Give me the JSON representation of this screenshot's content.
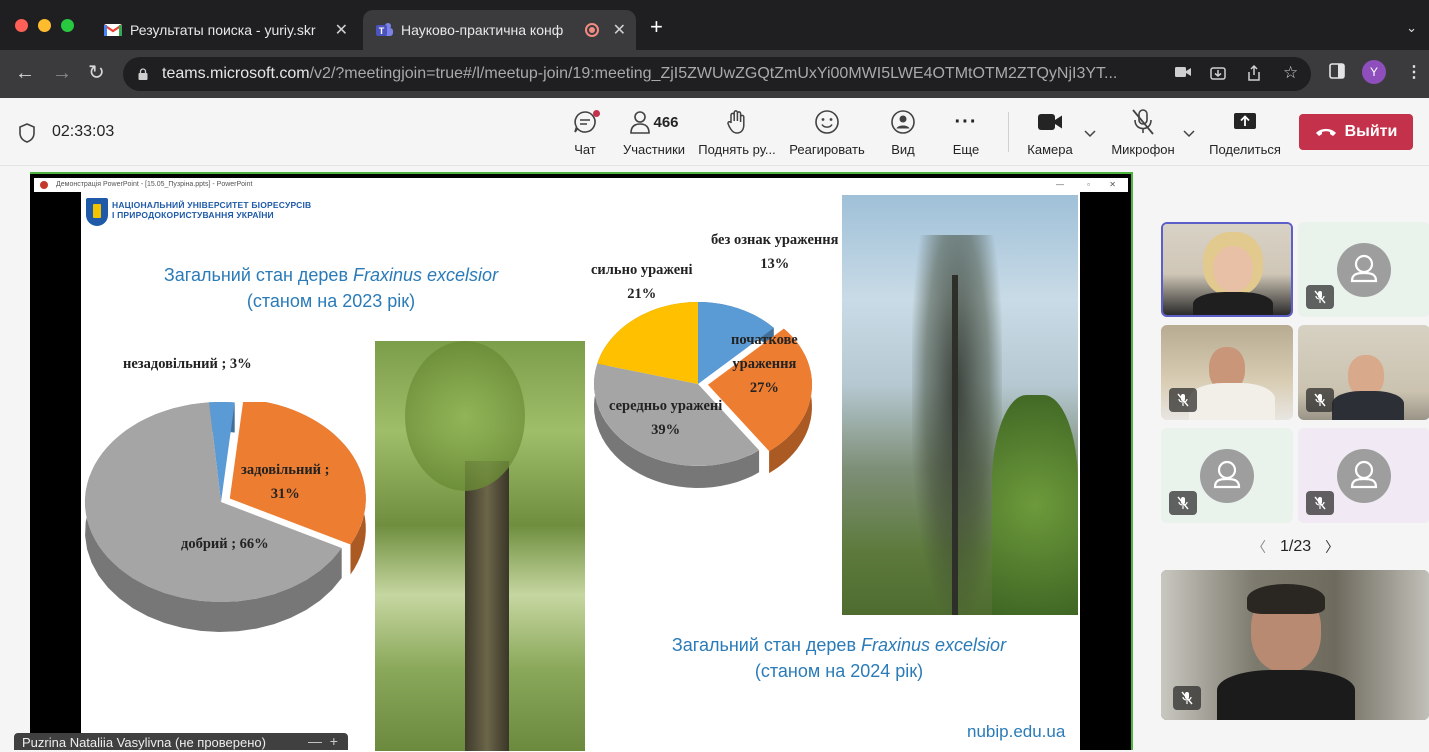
{
  "browser": {
    "tabs": [
      {
        "title": "Результаты поиска - yuriy.skr",
        "icon": "gmail-icon",
        "active": false
      },
      {
        "title": "Науково-практична конф",
        "icon": "teams-icon",
        "active": true,
        "recording": true
      }
    ],
    "url_host": "teams.microsoft.com",
    "url_path": "/v2/?meetingjoin=true#/l/meetup-join/19:meeting_ZjI5ZWUwZGQtZmUxYi00MWI5LWE4OTMtOTM2ZTQyNjI3YT...",
    "profile_initial": "Y",
    "profile_color": "#8e4fbd"
  },
  "meeting": {
    "timer": "02:33:03",
    "controls": {
      "chat": "Чат",
      "participants": "Участники",
      "participants_count": "466",
      "raise_hand": "Поднять ру...",
      "react": "Реагировать",
      "view": "Вид",
      "more": "Еще",
      "camera": "Камера",
      "mic": "Микрофон",
      "share": "Поделиться",
      "leave": "Выйти"
    },
    "leave_color": "#c4314b",
    "pager": "1/23",
    "presenter_name": "Puzrina Nataliia Vasylivna (не проверено)"
  },
  "slide": {
    "window_title": "Демонстрація PowerPoint - [15.05_Пузріна.ppts] - PowerPoint",
    "university": [
      "НАЦІОНАЛЬНИЙ УНІВЕРСИТЕТ БІОРЕСУРСІВ",
      "І ПРИРОДОКОРИСТУВАННЯ УКРАЇНИ"
    ],
    "title_2023_prefix": "Загальний стан дерев ",
    "title_species": "Fraxinus excelsior",
    "title_2023_line2": "(станом на 2023 рік)",
    "title_2024_prefix": "Загальний стан дерев ",
    "title_2024_line2": "(станом на 2024 рік)",
    "website": "nubip.edu.ua"
  },
  "chart_data": [
    {
      "type": "pie",
      "title": "Загальний стан дерев Fraxinus excelsior (станом на 2023 рік)",
      "labels": [
        "незадовільний",
        "задовільний",
        "добрий"
      ],
      "values": [
        3,
        31,
        66
      ],
      "display_labels": [
        "незадовільний ; 3%",
        "задовільний ;",
        "31%",
        "добрий ; 66%"
      ],
      "colors": [
        "#5b9bd5",
        "#ed7d31",
        "#a5a5a5"
      ]
    },
    {
      "type": "pie",
      "title": "Загальний стан дерев Fraxinus excelsior (станом на 2024 рік)",
      "labels": [
        "без ознак ураження",
        "початкове ураження",
        "середньо уражені",
        "сильно уражені"
      ],
      "values": [
        13,
        27,
        39,
        21
      ],
      "display_labels": [
        "без ознак ураження",
        "13%",
        "початкове",
        "ураження",
        "27%",
        "середньо уражені",
        "39%",
        "сильно уражені",
        "21%"
      ],
      "colors": [
        "#5b9bd5",
        "#ed7d31",
        "#a5a5a5",
        "#ffc000"
      ]
    }
  ]
}
